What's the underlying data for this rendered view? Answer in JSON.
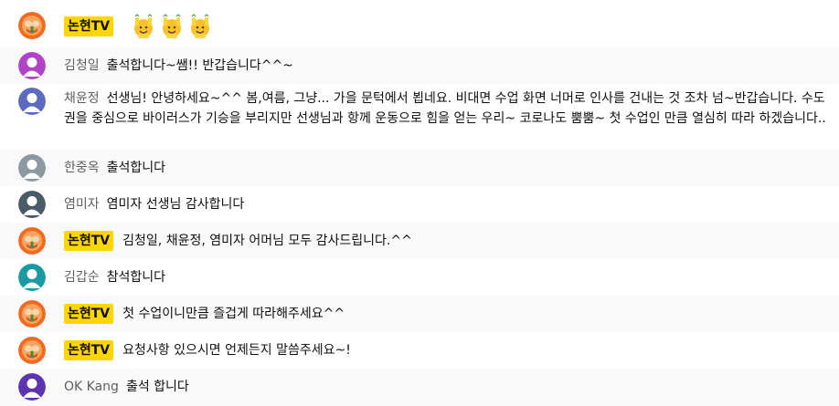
{
  "messages": [
    {
      "author": "논현TV",
      "owner": true,
      "text": "",
      "emojis": [
        "hands-raised-face-emoji",
        "hands-raised-face-emoji",
        "hands-raised-face-emoji"
      ]
    },
    {
      "author": "김청일",
      "owner": false,
      "text": "출석합니다~쌤!! 반갑습니다^^~",
      "avatar_color": "#b043c6"
    },
    {
      "author": "채윤정",
      "owner": false,
      "text": "선생님! 안녕하세요~^^ 봄,여름, 그냥... 가을 문턱에서 뵙네요. 비대면 수업 화면 너머로 인사를 건내는 것 조차 넘~반갑습니다. 수도권을 중심으로 바이러스가 기승을 부리지만 선생님과 항께 운동으로 힘을 얻는 우리~ 코로나도 뿜뿜~ 첫 수업인 만큼 열심히 따라 하겠습니다..",
      "avatar_color": "#5c6bc0"
    },
    {
      "author": "한중옥",
      "owner": false,
      "text": "출석합니다",
      "avatar_color": "#8d98a1"
    },
    {
      "author": "염미자",
      "owner": false,
      "text": "염미자 선생님 감사합니다",
      "avatar_color": "#4b5a68"
    },
    {
      "author": "논현TV",
      "owner": true,
      "text": "김청일, 채윤정, 염미자 어머님 모두 감사드립니다.^^"
    },
    {
      "author": "김갑순",
      "owner": false,
      "text": "참석합니다",
      "avatar_color": "#1b9aa2"
    },
    {
      "author": "논현TV",
      "owner": true,
      "text": "첫 수업이니만큼 즐겁게 따라해주세요^^"
    },
    {
      "author": "논현TV",
      "owner": true,
      "text": "요청사항 있으시면 언제든지 말씀주세요~!"
    },
    {
      "author": "OK Kang",
      "owner": false,
      "text": "출석 합니다",
      "avatar_color": "#5e35b1"
    }
  ]
}
